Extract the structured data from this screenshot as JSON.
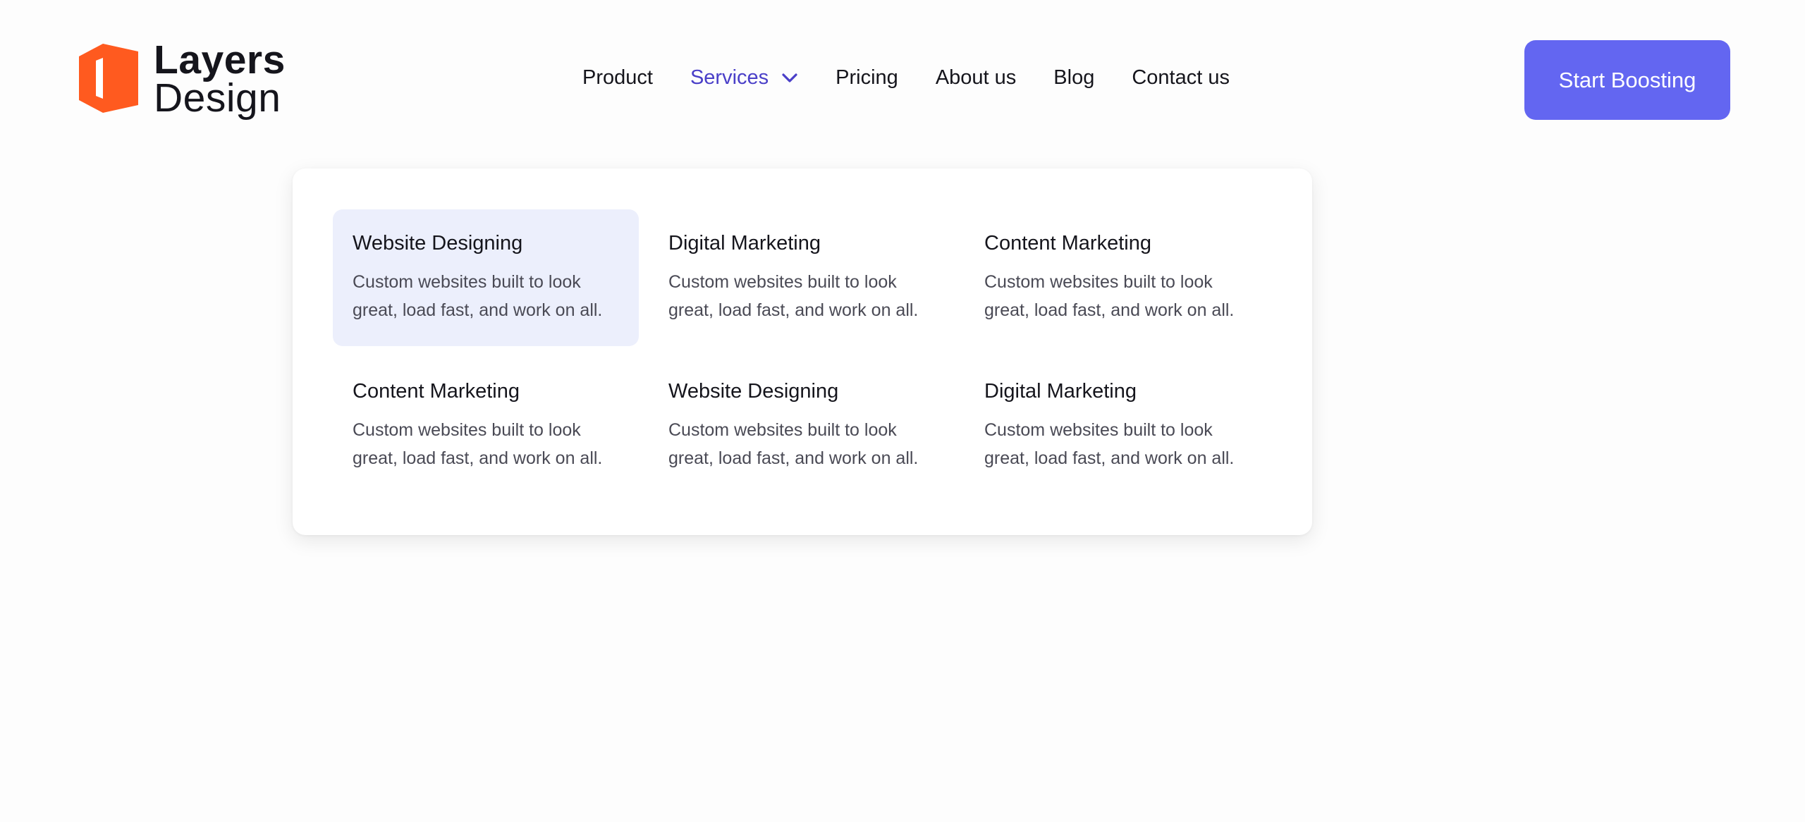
{
  "brand": {
    "name_line1": "Layers",
    "name_line2": "Design",
    "logo_color": "#ff5a1f"
  },
  "nav": {
    "items": [
      {
        "label": "Product"
      },
      {
        "label": "Services",
        "active": true
      },
      {
        "label": "Pricing"
      },
      {
        "label": "About us"
      },
      {
        "label": "Blog"
      },
      {
        "label": "Contact us"
      }
    ],
    "active_color": "#4a3fc8"
  },
  "cta": {
    "label": "Start Boosting",
    "color": "#6366f1"
  },
  "services_menu": {
    "items": [
      {
        "title": "Website Designing",
        "description": "Custom websites built to look great, load fast, and work on all.",
        "highlighted": true
      },
      {
        "title": "Digital Marketing",
        "description": "Custom websites built to look great, load fast, and work on all."
      },
      {
        "title": "Content Marketing",
        "description": "Custom websites built to look great, load fast, and work on all."
      },
      {
        "title": "Content Marketing",
        "description": "Custom websites built to look great, load fast, and work on all."
      },
      {
        "title": "Website Designing",
        "description": "Custom websites built to look great, load fast, and work on all."
      },
      {
        "title": "Digital Marketing",
        "description": "Custom websites built to look great, load fast, and work on all."
      }
    ],
    "highlight_color": "#eceffc"
  }
}
